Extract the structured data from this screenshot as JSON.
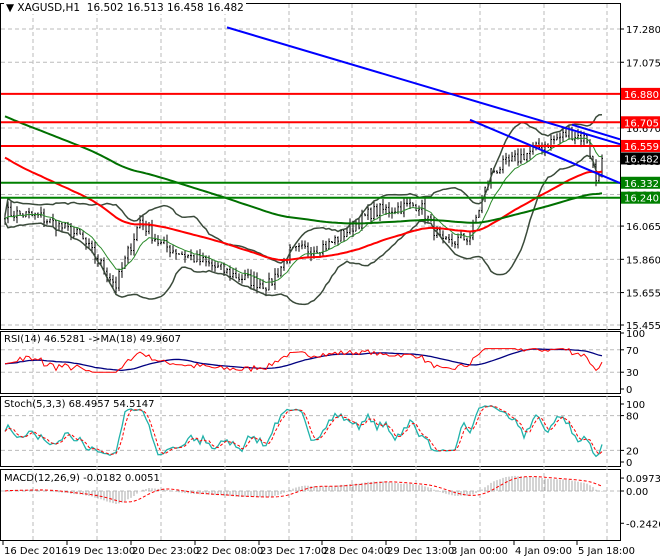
{
  "header": {
    "symbol": "XAGUSD,H1",
    "open": "16.502",
    "high": "16.513",
    "low": "16.458",
    "close": "16.482"
  },
  "indicators": {
    "rsi": "RSI(14) 46.5281  ->MA(18) 49.9607",
    "stoch": "Stoch(5,3,3) 68.4957 54.5147",
    "macd": "MACD(12,26,9) -0.0182 0.0051"
  },
  "colors": {
    "resistance": "#ff0000",
    "support": "#008000",
    "trend": "#0000ff",
    "ma_fast": "#ff0000",
    "ma_slow": "#007000",
    "bands": "#3a4a3a",
    "rsi": "#ff0000",
    "rsi_ma": "#000080",
    "stoch_main": "#20b2aa",
    "stoch_signal": "#ff0000"
  },
  "chart_data": {
    "type": "candlestick",
    "title": "XAGUSD,H1",
    "price_axis": {
      "ticks": [
        "17.280",
        "17.075",
        "16.880",
        "16.670",
        "16.465",
        "16.260",
        "16.065",
        "15.860",
        "15.655",
        "15.455"
      ],
      "range": [
        15.455,
        17.29
      ]
    },
    "time_axis": {
      "ticks": [
        "16 Dec 2016",
        "19 Dec 13:00",
        "20 Dec 23:00",
        "22 Dec 08:00",
        "23 Dec 17:00",
        "28 Dec 04:00",
        "29 Dec 13:00",
        "3 Jan 00:00",
        "4 Jan 09:00",
        "5 Jan 18:00"
      ]
    },
    "bars": 200,
    "close_path": [
      [
        0,
        16.15
      ],
      [
        12,
        16.12
      ],
      [
        25,
        16.0
      ],
      [
        37,
        15.7
      ],
      [
        45,
        16.1
      ],
      [
        52,
        15.95
      ],
      [
        65,
        15.85
      ],
      [
        78,
        15.75
      ],
      [
        88,
        15.7
      ],
      [
        95,
        15.9
      ],
      [
        108,
        15.95
      ],
      [
        122,
        16.15
      ],
      [
        138,
        16.2
      ],
      [
        146,
        15.95
      ],
      [
        155,
        16.0
      ],
      [
        162,
        16.4
      ],
      [
        178,
        16.55
      ],
      [
        188,
        16.64
      ],
      [
        194,
        16.6
      ],
      [
        197,
        16.35
      ],
      [
        199,
        16.48
      ]
    ],
    "levels": [
      {
        "label": "16.880",
        "price": 16.88,
        "kind": "resistance"
      },
      {
        "label": "16.705",
        "price": 16.705,
        "kind": "resistance"
      },
      {
        "label": "16.559",
        "price": 16.559,
        "kind": "resistance"
      },
      {
        "label": "16.482",
        "price": 16.482,
        "kind": "current"
      },
      {
        "label": "16.332",
        "price": 16.332,
        "kind": "support"
      },
      {
        "label": "16.240",
        "price": 16.24,
        "kind": "support"
      }
    ],
    "trendlines": [
      [
        [
          74,
          17.29
        ],
        [
          205,
          16.57
        ]
      ],
      [
        [
          155,
          16.72
        ],
        [
          205,
          16.33
        ]
      ],
      [
        [
          189,
          16.69
        ],
        [
          205,
          16.6
        ]
      ]
    ],
    "rsi_axis": [
      "100",
      "70",
      "30",
      "0"
    ],
    "stoch_axis": [
      "100",
      "80",
      "20",
      "0"
    ],
    "macd_axis": [
      "0.0973",
      "0.00",
      "-0.2426"
    ]
  }
}
